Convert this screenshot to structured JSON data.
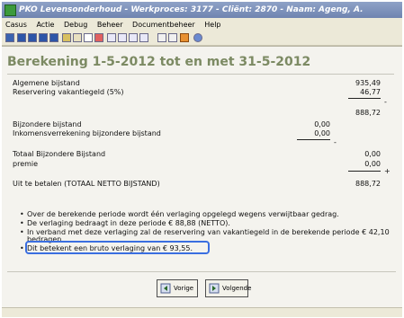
{
  "window": {
    "title": "PKO Levensonderhoud - Werkproces: 3177 - Cliënt: 2870 - Naam: Ageng, A."
  },
  "menu": [
    "Casus",
    "Actie",
    "Debug",
    "Beheer",
    "Documentbeheer",
    "Help"
  ],
  "toolbar_icons": [
    "save-icon",
    "first-icon",
    "prev-icon",
    "next-icon",
    "last-icon",
    "document-icon",
    "edit-icon",
    "new-icon",
    "delete-icon",
    "list-icon",
    "report-icon",
    "print-icon",
    "calc-icon",
    "table-icon",
    "properties-icon",
    "active-icon",
    "help-icon"
  ],
  "page": {
    "title": "Berekening 1-5-2012 tot en met 31-5-2012"
  },
  "rows": {
    "algemene_label": "Algemene bijstand",
    "algemene_value": "935,49",
    "reservering_label": "Reservering vakantiegeld (5%)",
    "reservering_value": "46,77",
    "minus1": "-",
    "subtotal1": "888,72",
    "bijzondere_label": "Bijzondere bijstand",
    "bijzondere_value": "0,00",
    "inkomens_label": "Inkomensverrekening bijzondere bijstand",
    "inkomens_value": "0,00",
    "minus2": "-",
    "totaal_label": "Totaal Bijzondere Bijstand",
    "totaal_value": "0,00",
    "premie_label": "premie",
    "premie_value": "0,00",
    "plus": "+",
    "uit_label": "Uit te betalen (TOTAAL NETTO BIJSTAND)",
    "uit_value": "888,72"
  },
  "notes": [
    "Over de berekende periode wordt één verlaging opgelegd wegens verwijtbaar gedrag.",
    "De verlaging bedraagt in deze periode € 88,88 (NETTO).",
    "In verband met deze verlaging zal de reservering van vakantiegeld in de berekende periode € 42,10",
    "bedragen.",
    "Dit betekent een bruto verlaging van € 93,55."
  ],
  "buttons": {
    "prev": "Vorige",
    "next": "Volgende"
  }
}
